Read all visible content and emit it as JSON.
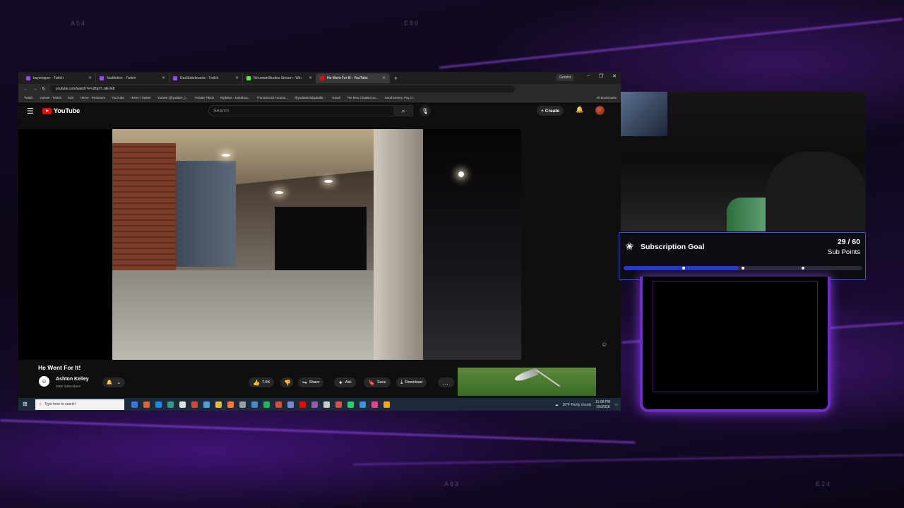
{
  "overlay": {
    "deco_labels": [
      "A64",
      "E80",
      "A83",
      "E24"
    ]
  },
  "browser": {
    "tabs": [
      {
        "label": "kaystripper - Twitch",
        "active": false
      },
      {
        "label": "ItsaMotive - Twitch",
        "active": false
      },
      {
        "label": "DaxStateboards - Twitch",
        "active": false
      },
      {
        "label": "MountainStudios Stream - Win",
        "active": false
      },
      {
        "label": "He Went For It! - YouTube",
        "active": true
      }
    ],
    "gemini_label": "Gemini",
    "url": "youtube.com/watch?v=uHgrH..ldkrIe8",
    "bookmarks": [
      "Twitch",
      "YoDate - Twitch",
      "Kick",
      "Home - Restream",
      "YouTube",
      "Home / Twitter",
      "YoDate (@yodatrr_)...",
      "YoDate Tiktok",
      "Nightbot - Dashboa...",
      "The Discord Forums...",
      "@yodatrticlubydailla...",
      "Gmail",
      "The best ChatBot so...",
      "Send Money, Pay O..."
    ],
    "all_bookmarks": "All Bookmarks"
  },
  "youtube": {
    "logo": "YouTube",
    "search_placeholder": "Search",
    "create_label": "Create",
    "video_title": "He Went For It!",
    "channel_name": "Ashton Kelley",
    "channel_initial": "☺",
    "subscribers": "335K subscribers",
    "actions": {
      "likes": "7.6K",
      "share": "Share",
      "ask": "Ask",
      "save": "Save",
      "download": "Download"
    }
  },
  "taskbar": {
    "search_placeholder": "Type here to search",
    "weather": "30°F Partly cloudy",
    "time": "11:08 PM",
    "date": "1/6/2026",
    "icon_colors": [
      "#3a78d8",
      "#e8602c",
      "#1e88e5",
      "#2a9d8f",
      "#e0e0e0",
      "#db4437",
      "#4aa3df",
      "#e6b93a",
      "#ff7a2e",
      "#9aa0a6",
      "#4a88c8",
      "#1db954",
      "#d64f3a",
      "#7289da",
      "#ff0000",
      "#9b59b6",
      "#ccc",
      "#e74c3c",
      "#2ecc71",
      "#3498db",
      "#e84393",
      "#ffa502"
    ]
  },
  "subscription_goal": {
    "title": "Subscription Goal",
    "count": "29 / 60",
    "unit": "Sub Points",
    "current": 29,
    "target": 60,
    "milestones": [
      0.25,
      0.5,
      0.75
    ],
    "accent": "#2339d0"
  },
  "colors": {
    "youtube_red": "#ff0000",
    "overlay_purple": "#6d2cc8"
  }
}
